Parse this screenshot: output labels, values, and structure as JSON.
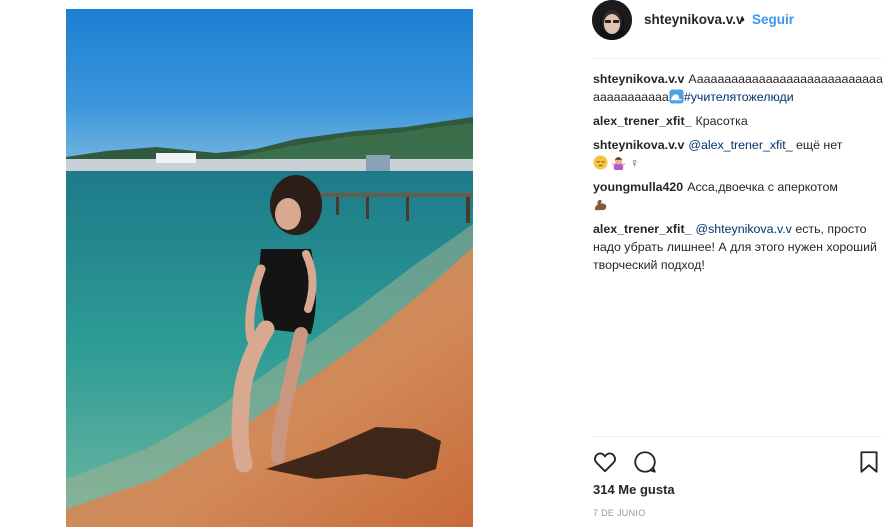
{
  "post": {
    "username": "shteynikova.v.v",
    "separator": "•",
    "follow_label": "Seguir",
    "likes": "314 Me gusta",
    "date": "7 DE JUNIO"
  },
  "comments": [
    {
      "user": "shteynikova.v.v",
      "text": "Ааааааааааааааааааааааааааааааааааааааа",
      "emoji": "wave-emoji",
      "hashtag": "#учителятожелюди"
    },
    {
      "user": "alex_trener_xfit_",
      "text": "Красотка"
    },
    {
      "user": "shteynikova.v.v",
      "mention": "@alex_trener_xfit_",
      "text": "ещё нет",
      "emojis": [
        "pensive-face-emoji",
        "woman-shrugging-emoji",
        "female-sign-emoji"
      ],
      "female_sign": "♀"
    },
    {
      "user": "youngmulla420",
      "text": "Асса,двоечка с аперкотом",
      "emoji": "flexed-biceps-emoji"
    },
    {
      "user": "alex_trener_xfit_",
      "mention": "@shteynikova.v.v",
      "text": "есть, просто надо убрать лишнее! А для этого нужен хороший творческий подход!"
    }
  ],
  "icons": {
    "like": "heart-icon",
    "comment": "comment-icon",
    "save": "bookmark-icon"
  },
  "colors": {
    "follow": "#3897f0",
    "link": "#003569",
    "text": "#262626",
    "meta": "#999999"
  }
}
